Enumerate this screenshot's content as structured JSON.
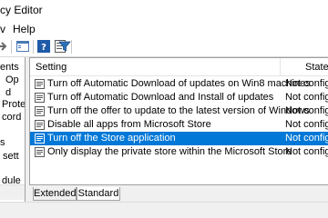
{
  "window": {
    "title": "cy Editor"
  },
  "menu": {
    "view": "v",
    "help": "Help"
  },
  "toolbar": {
    "buttons": [
      "back-icon",
      "forward-icon",
      "show-hide-tree-icon",
      "help-icon",
      "properties-icon",
      "filter-icon"
    ]
  },
  "tree": {
    "items": [
      "ents",
      "Op",
      "d",
      "Prote",
      "cord",
      "",
      "s",
      "sett",
      "dule"
    ]
  },
  "list": {
    "header": {
      "setting": "Setting",
      "state": "State"
    },
    "rows": [
      {
        "name": "Turn off Automatic Download of updates on Win8 machines",
        "state": "Not configu",
        "selected": false
      },
      {
        "name": "Turn off Automatic Download and Install of updates",
        "state": "Not configu",
        "selected": false
      },
      {
        "name": "Turn off the offer to update to the latest version of Windows",
        "state": "Not configu",
        "selected": false
      },
      {
        "name": "Disable all apps from Microsoft Store",
        "state": "Not configu",
        "selected": false
      },
      {
        "name": "Turn off the Store application",
        "state": "Not configu",
        "selected": true
      },
      {
        "name": "Only display the private store within the Microsoft Store",
        "state": "Not configu",
        "selected": false
      }
    ]
  },
  "tabs": {
    "extended": "Extended",
    "standard": "Standard"
  },
  "colors": {
    "selection": "#0078d7",
    "pane_border": "#a0a0a0"
  }
}
